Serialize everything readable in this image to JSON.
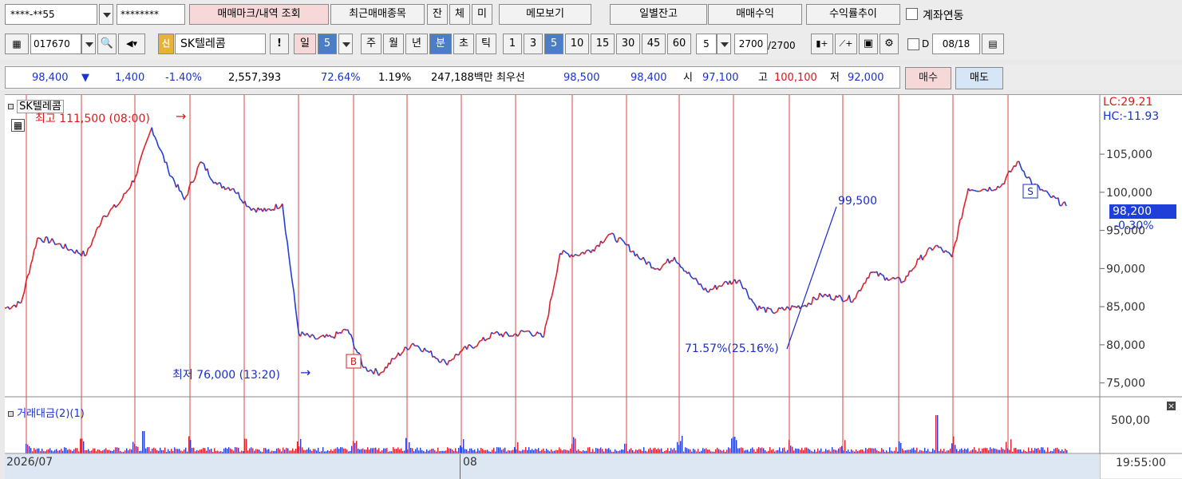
{
  "toolbar1": {
    "account": "****-**55",
    "password": "********",
    "trade_mark_btn": "매매마크/내역 조회",
    "recent_btn": "최근매매종목",
    "tab_jan": "잔",
    "tab_che": "체",
    "tab_mi": "미",
    "memo_btn": "메모보기",
    "daily_balance_btn": "일별잔고",
    "trade_profit_btn": "매매수익",
    "return_trend_btn": "수익률추이",
    "account_link_label": "계좌연동"
  },
  "toolbar2": {
    "code": "017670",
    "badge": "신",
    "stock_name": "SK텔레콤",
    "alert": "!",
    "period_day": "일",
    "period_day_value": "5",
    "period_week": "주",
    "period_month": "월",
    "period_year": "년",
    "period_min": "분",
    "period_sec": "초",
    "period_tick": "틱",
    "intervals": [
      "1",
      "3",
      "5",
      "10",
      "15",
      "30",
      "45",
      "60"
    ],
    "interval_custom": "5",
    "count_value": "2700",
    "count_total": "/2700",
    "date_prefix": "D",
    "date": "08/18"
  },
  "quote": {
    "price": "98,400",
    "change": "1,400",
    "change_pct": "-1.40%",
    "volume": "2,557,393",
    "vol_ratio": "72.64%",
    "turnover": "1.19%",
    "amount": "247,188백만",
    "best_label": "최우선",
    "best_ask": "98,500",
    "best_bid": "98,400",
    "open_label": "시",
    "open": "97,100",
    "high_label": "고",
    "high": "100,100",
    "low_label": "저",
    "low": "92,000",
    "buy_btn": "매수",
    "sell_btn": "매도"
  },
  "chart": {
    "stock_title": "SK텔레콤",
    "high_note": "최고 111,500 (08:00)",
    "low_note": "최저 76,000 (13:20)",
    "lc": "LC:29.21",
    "hc": "HC:-11.93",
    "current_price": "98,200",
    "current_pct": "-0.30%",
    "trend_top_label": "99,500",
    "trend_bottom_label": "71.57%(25.16%)",
    "marker_b": "B",
    "marker_s": "S",
    "volume_title": "거래대금(2)(1)",
    "volume_tick": "500,00",
    "date_label_left": "2026/07",
    "date_label_mid": "08",
    "time_label": "19:55:00",
    "colors": {
      "up": "#e0202a",
      "down": "#1f3fd8",
      "session_line": "#d84040",
      "trend": "#1a2cd0"
    }
  },
  "chart_data": {
    "type": "line",
    "title": "SK텔레콤",
    "y_ticks": [
      "105,000",
      "100,000",
      "95,000",
      "90,000",
      "85,000",
      "80,000",
      "75,000"
    ],
    "ylim": [
      73500,
      111500
    ],
    "x_labels": [
      "2026/07",
      "08"
    ],
    "series": [
      {
        "name": "SK텔레콤",
        "values": [
          84800,
          85500,
          94000,
          93500,
          92500,
          91800,
          96800,
          98500,
          102000,
          108500,
          103000,
          99000,
          104000,
          101000,
          100500,
          98000,
          97500,
          98500,
          81500,
          80800,
          81000,
          82000,
          77000,
          76300,
          78500,
          80200,
          79000,
          77600,
          79200,
          80200,
          81500,
          81200,
          81800,
          81000,
          92000,
          91800,
          92500,
          94500,
          93200,
          91200,
          90000,
          91500,
          89000,
          87000,
          88000,
          88500,
          85000,
          84300,
          84800,
          85200,
          86500,
          86200,
          86000,
          89500,
          88800,
          88300,
          91200,
          93000,
          91500,
          100500,
          100400,
          100800,
          104000,
          101000,
          99500,
          98200
        ]
      }
    ]
  }
}
